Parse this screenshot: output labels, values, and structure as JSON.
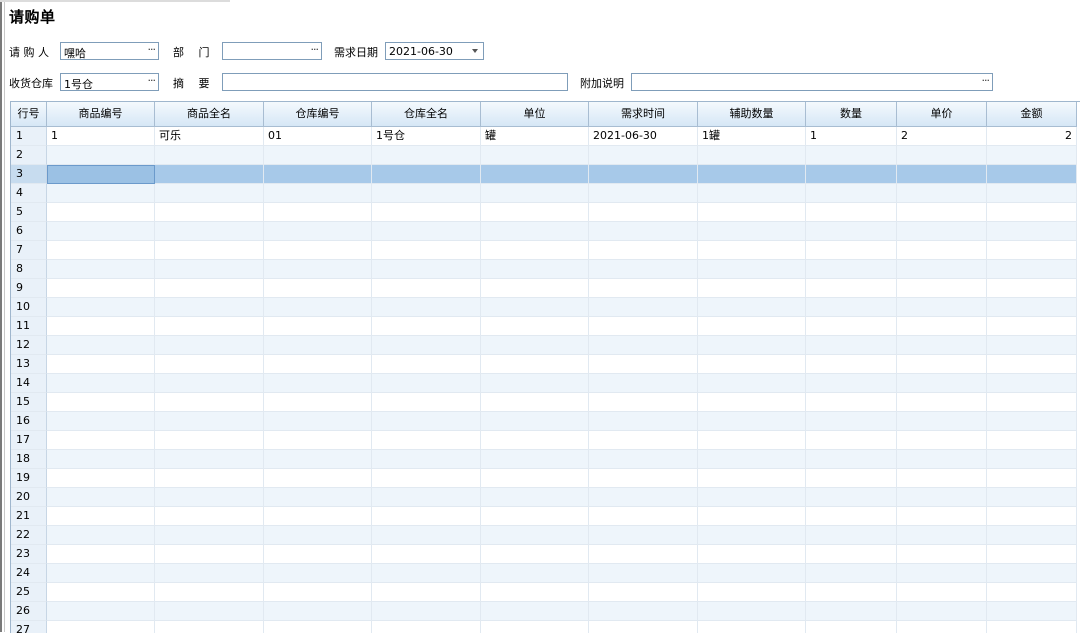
{
  "title": "请购单",
  "form": {
    "requester_label": "请 购 人",
    "requester_value": "嘿哈",
    "dept_label": "部　 门",
    "dept_value": "",
    "date_label": "需求日期",
    "date_value": "2021-06-30",
    "warehouse_label": "收货仓库",
    "warehouse_value": "1号仓",
    "summary_label": "摘　 要",
    "summary_value": "",
    "note_label": "附加说明",
    "note_value": ""
  },
  "table": {
    "headers": [
      "行号",
      "商品编号",
      "商品全名",
      "仓库编号",
      "仓库全名",
      "单位",
      "需求时间",
      "辅助数量",
      "数量",
      "单价",
      "金额"
    ],
    "first_row": [
      "1",
      "可乐",
      "01",
      "1号仓",
      "罐",
      "2021-06-30",
      "1罐",
      "1",
      "2",
      "2"
    ],
    "row_numbers": [
      "1",
      "2",
      "3",
      "4",
      "5",
      "6",
      "7",
      "8",
      "9",
      "10",
      "11",
      "12",
      "13",
      "14",
      "15",
      "16",
      "17",
      "18",
      "19",
      "20",
      "21",
      "22",
      "23",
      "24",
      "25",
      "26",
      "27"
    ],
    "selected_row": "3"
  }
}
